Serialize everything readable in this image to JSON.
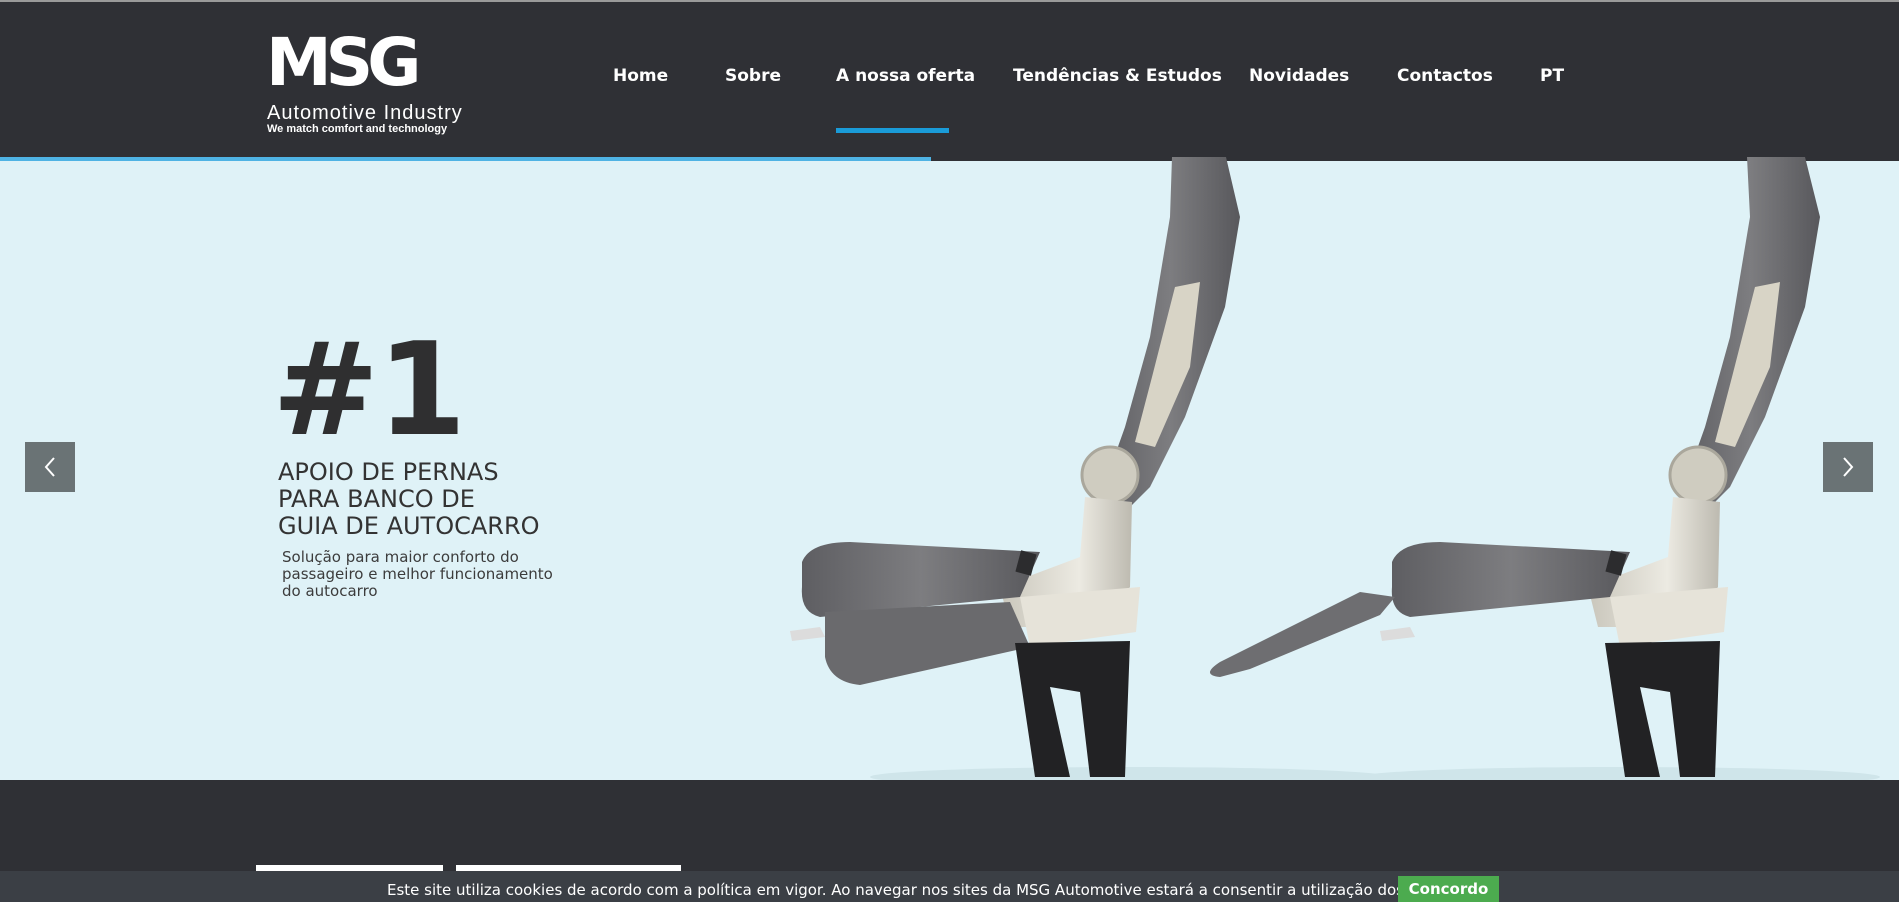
{
  "header": {
    "logo": {
      "mark": "MSG",
      "line1": "Automotive  Industry",
      "line2": "We match comfort and technology"
    },
    "nav": [
      {
        "label": "Home"
      },
      {
        "label": "Sobre"
      },
      {
        "label": "A nossa oferta",
        "active": true
      },
      {
        "label": "Tendências & Estudos"
      },
      {
        "label": "Novidades"
      },
      {
        "label": "Contactos"
      },
      {
        "label": "PT"
      }
    ],
    "active_color": "#1a9bd8"
  },
  "slider": {
    "progress": 0.49,
    "number": "#1",
    "title_lines": [
      "APOIO DE PERNAS",
      "PARA BANCO DE",
      "GUIA DE AUTOCARRO"
    ],
    "subtitle_lines": [
      "Solução para maior conforto do",
      "passageiro e melhor funcionamento",
      "do autocarro"
    ],
    "background": "#dff2f7",
    "prev_icon": "chevron-left-icon",
    "next_icon": "chevron-right-icon"
  },
  "cookie": {
    "text": "Este site utiliza cookies de acordo com a política em vigor. Ao navegar nos sites da MSG Automotive estará a consentir a utilização dos cookies.",
    "button": "Concordo",
    "button_color": "#4cab4f"
  }
}
